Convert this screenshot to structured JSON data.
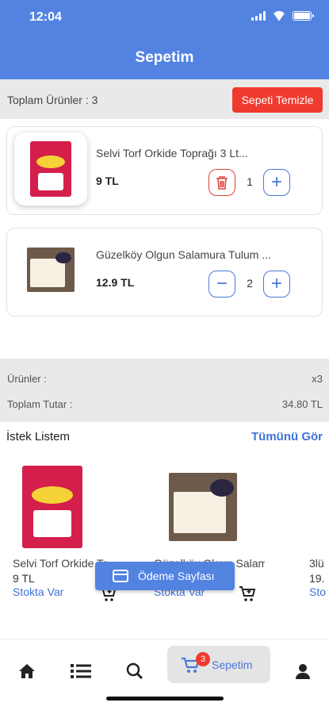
{
  "status_bar": {
    "time": "12:04"
  },
  "header": {
    "title": "Sepetim"
  },
  "toolbar": {
    "total_items": "Toplam Ürünler : 3",
    "clear_label": "Sepeti Temizle"
  },
  "cart": [
    {
      "name": "Selvi Torf Orkide Toprağı 3 Lt...",
      "price": "9 TL",
      "quantity": "1"
    },
    {
      "name": "Güzelköy Olgun Salamura Tulum ...",
      "price": "12.9 TL",
      "quantity": "2"
    }
  ],
  "summary": {
    "products_label": "Ürünler :",
    "products_value": "x3",
    "total_label": "Toplam Tutar :",
    "total_value": "34.80 TL"
  },
  "wishlist": {
    "title": "İstek Listem",
    "see_all": "Tümünü Gör",
    "items": [
      {
        "name": "Selvi Torf Orkide To",
        "price": "9 TL",
        "stock": "Stokta Var"
      },
      {
        "name": "Güzelköy Olgun Salamu...",
        "price": "",
        "stock": "Stokta Var"
      },
      {
        "name": "3lü",
        "price": "19.",
        "stock": "Sto"
      }
    ]
  },
  "checkout": {
    "label": "Ödeme Sayfası"
  },
  "nav": {
    "cart_label": "Sepetim",
    "cart_badge": "3"
  },
  "colors": {
    "primary": "#5383e1",
    "danger": "#ef3b2f",
    "link": "#3f73d9"
  },
  "icons": [
    "home-icon",
    "list-icon",
    "search-icon",
    "cart-icon",
    "user-icon",
    "trash-icon",
    "plus-icon",
    "minus-icon",
    "credit-card-icon",
    "add-to-cart-icon"
  ]
}
